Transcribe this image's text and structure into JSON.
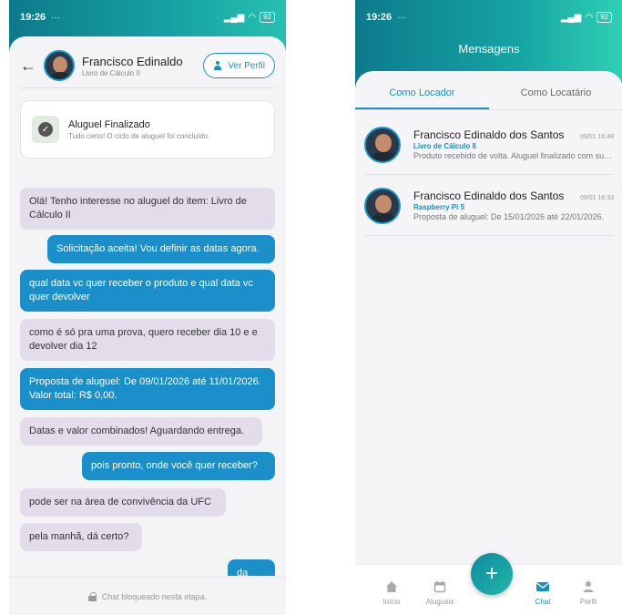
{
  "left": {
    "status_bar": {
      "time": "19:26",
      "dots": "···",
      "battery": "92"
    },
    "header": {
      "name": "Francisco Edinaldo",
      "subtitle": "Livro de Cálculo II",
      "profile_button": "Ver Perfil"
    },
    "status_card": {
      "title": "Aluguel Finalizado",
      "subtitle": "Tudo certo! O ciclo de aluguel foi concluído."
    },
    "messages": [
      {
        "dir": "in",
        "text": "Olá! Tenho interesse no aluguel do item: Livro de Cálculo II"
      },
      {
        "dir": "out",
        "text": "Solicitação aceita! Vou definir as datas agora."
      },
      {
        "dir": "out",
        "text": "qual data vc quer receber o produto e qual data vc quer devolver"
      },
      {
        "dir": "in",
        "text": "como é só pra uma prova, quero receber dia 10 e e devolver dia 12"
      },
      {
        "dir": "out",
        "text": "Proposta de aluguel: De 09/01/2026 até 11/01/2026. Valor total: R$ 0,00."
      },
      {
        "dir": "in",
        "text": "Datas e valor combinados! Aguardando entrega."
      },
      {
        "dir": "out",
        "text": "pois pronto, onde você quer receber?"
      },
      {
        "dir": "in",
        "text": "pode ser na área de convivência da UFC"
      },
      {
        "dir": "in",
        "text": "pela manhã, dá certo?"
      },
      {
        "dir": "out",
        "text": "da sim"
      }
    ],
    "locked_text": "Chat bloqueado nesta etapa."
  },
  "right": {
    "status_bar": {
      "time": "19:26",
      "dots": "···",
      "battery": "92"
    },
    "title": "Mensagens",
    "tabs": [
      {
        "label": "Como Locador",
        "active": true
      },
      {
        "label": "Como Locatário",
        "active": false
      }
    ],
    "conversations": [
      {
        "name": "Francisco Edinaldo dos Santos",
        "time": "09/01 16:48",
        "item": "Livro de Cálculo II",
        "preview": "Produto recebido de volta. Aluguel finalizado com sucesso."
      },
      {
        "name": "Francisco Edinaldo dos Santos",
        "time": "09/01 16:33",
        "item": "Raspberry Pi 5",
        "preview": "Proposta de aluguel: De 15/01/2026 até 22/01/2026."
      }
    ],
    "nav": [
      {
        "label": "Início",
        "icon": "home-icon"
      },
      {
        "label": "Aluguéis",
        "icon": "calendar-icon"
      },
      {
        "label": "Chat",
        "icon": "chat-icon",
        "active": true
      },
      {
        "label": "Perfil",
        "icon": "person-icon"
      }
    ],
    "fab_label": "+"
  },
  "colors": {
    "accent": "#1a8fc4",
    "gradient_start": "#0d7a8c",
    "gradient_end": "#27c0b0",
    "incoming_bubble": "#e3dcea",
    "outgoing_bubble": "#1a8fc9"
  }
}
